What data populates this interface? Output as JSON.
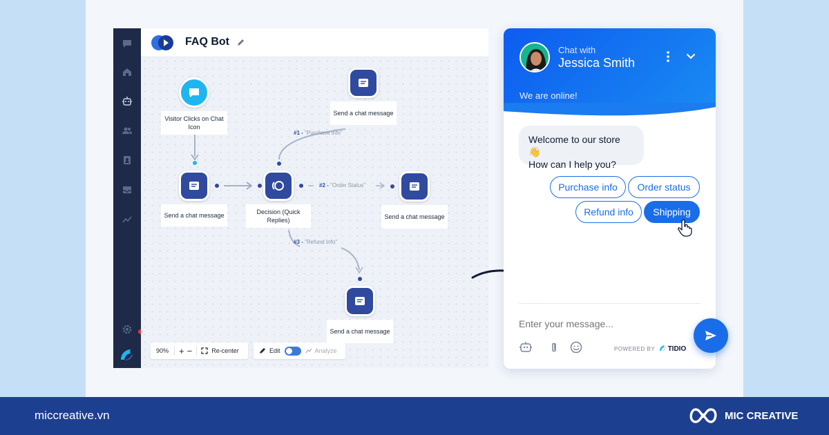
{
  "editor": {
    "title": "FAQ Bot",
    "sidebar_icons": [
      "chat-icon",
      "home-icon",
      "bot-icon",
      "users-icon",
      "contacts-icon",
      "inbox-icon",
      "analytics-icon",
      "settings-icon"
    ],
    "nodes": {
      "trigger": "Visitor Clicks on Chat Icon",
      "send1": "Send a chat message",
      "decision": "Decision (Quick Replies)",
      "send_top": "Send a chat message",
      "send_right": "Send a chat message",
      "send_bottom": "Send a chat message"
    },
    "edges": {
      "e1_num": "#1 -",
      "e1_text": "\"Purchase info\"",
      "e2_num": "#2 -",
      "e2_text": "\"Order Status\"",
      "e3_num": "#3 -",
      "e3_text": "\"Refund Info\""
    },
    "toolbar": {
      "zoom": "90%",
      "plus": "+",
      "minus": "−",
      "recenter": "Re-center",
      "edit": "Edit",
      "analyze": "Analyze"
    }
  },
  "chat": {
    "chat_with": "Chat with",
    "agent_name": "Jessica Smith",
    "status": "We are online!",
    "welcome_line1": "Welcome to our store 👋",
    "welcome_line2": "How can I help you?",
    "quick_replies": [
      "Purchase info",
      "Order status",
      "Refund info",
      "Shipping"
    ],
    "active_reply": "Shipping",
    "input_placeholder": "Enter your message...",
    "powered_by": "POWERED BY",
    "powered_brand": "TIDIO"
  },
  "footer": {
    "site": "miccreative.vn",
    "brand": "MIC CREATIVE"
  },
  "colors": {
    "accent": "#1a6de8",
    "node": "#2f4a9e",
    "sidebar": "#1e2a47",
    "footer": "#1d3f8f"
  }
}
